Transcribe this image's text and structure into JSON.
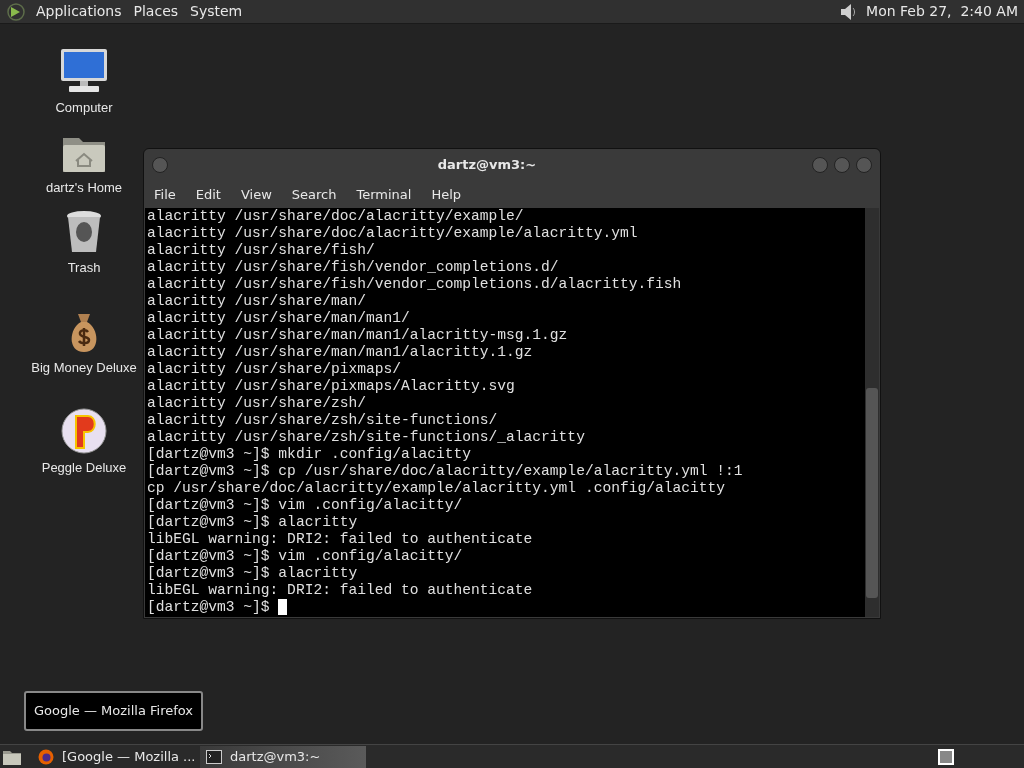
{
  "top_panel": {
    "menus": [
      "Applications",
      "Places",
      "System"
    ],
    "clock": "Mon Feb 27,  2:40 AM"
  },
  "desktop_icons": [
    {
      "label": "Computer",
      "kind": "computer"
    },
    {
      "label": "dartz's Home",
      "kind": "home"
    },
    {
      "label": "Trash",
      "kind": "trash"
    },
    {
      "label": "Big Money Deluxe",
      "kind": "moneybag"
    },
    {
      "label": "Peggle Deluxe",
      "kind": "peggle"
    }
  ],
  "terminal": {
    "title": "dartz@vm3:~",
    "menu": [
      "File",
      "Edit",
      "View",
      "Search",
      "Terminal",
      "Help"
    ],
    "lines": [
      "alacritty /usr/share/doc/alacritty/example/",
      "alacritty /usr/share/doc/alacritty/example/alacritty.yml",
      "alacritty /usr/share/fish/",
      "alacritty /usr/share/fish/vendor_completions.d/",
      "alacritty /usr/share/fish/vendor_completions.d/alacritty.fish",
      "alacritty /usr/share/man/",
      "alacritty /usr/share/man/man1/",
      "alacritty /usr/share/man/man1/alacritty-msg.1.gz",
      "alacritty /usr/share/man/man1/alacritty.1.gz",
      "alacritty /usr/share/pixmaps/",
      "alacritty /usr/share/pixmaps/Alacritty.svg",
      "alacritty /usr/share/zsh/",
      "alacritty /usr/share/zsh/site-functions/",
      "alacritty /usr/share/zsh/site-functions/_alacritty",
      "[dartz@vm3 ~]$ mkdir .config/alacitty",
      "[dartz@vm3 ~]$ cp /usr/share/doc/alacritty/example/alacritty.yml !:1",
      "cp /usr/share/doc/alacritty/example/alacritty.yml .config/alacitty",
      "[dartz@vm3 ~]$ vim .config/alacitty/",
      "[dartz@vm3 ~]$ alacritty",
      "libEGL warning: DRI2: failed to authenticate",
      "[dartz@vm3 ~]$ vim .config/alacitty/",
      "[dartz@vm3 ~]$ alacritty",
      "libEGL warning: DRI2: failed to authenticate",
      "[dartz@vm3 ~]$ "
    ]
  },
  "tooltip": "Google — Mozilla Firefox",
  "taskbar": [
    {
      "label": "[Google — Mozilla ...",
      "kind": "firefox",
      "selected": false
    },
    {
      "label": "dartz@vm3:~",
      "kind": "terminal",
      "selected": true
    }
  ]
}
